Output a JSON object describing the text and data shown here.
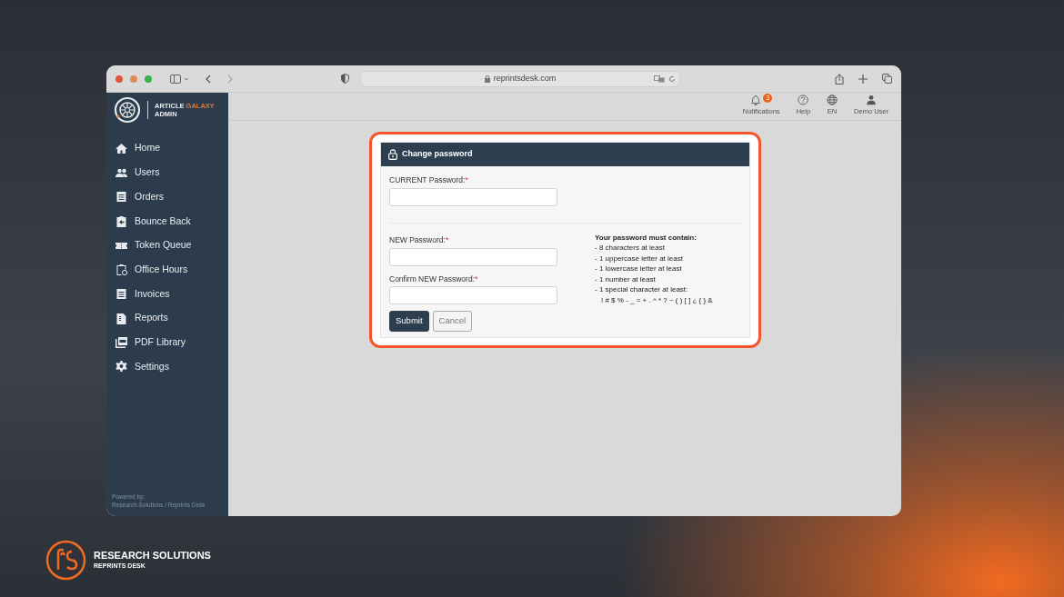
{
  "browser": {
    "url": "reprintsdesk.com"
  },
  "logo": {
    "word_1": "ARTICLE",
    "word_2": "GALAXY",
    "word_3": "ADMIN"
  },
  "sidebar": {
    "items": [
      {
        "label": "Home"
      },
      {
        "label": "Users"
      },
      {
        "label": "Orders"
      },
      {
        "label": "Bounce Back"
      },
      {
        "label": "Token Queue"
      },
      {
        "label": "Office Hours"
      },
      {
        "label": "Invoices"
      },
      {
        "label": "Reports"
      },
      {
        "label": "PDF Library"
      },
      {
        "label": "Settings"
      }
    ],
    "footer": [
      "Powered by:",
      "Research Solutions / Reprints Desk"
    ]
  },
  "header": {
    "items": [
      {
        "label": "Notifications",
        "badge": "3"
      },
      {
        "label": "Help"
      },
      {
        "label": "EN"
      },
      {
        "label": "Demo User"
      }
    ]
  },
  "dialog": {
    "title": "Change password",
    "current_field": {
      "label": "CURRENT Password:",
      "required_mark": "*"
    },
    "new_fields": [
      {
        "label": "NEW Password:",
        "required_mark": "*"
      },
      {
        "label": "Confirm NEW Password:",
        "required_mark": "*"
      }
    ],
    "rules": {
      "heading": "Your password must contain:",
      "items": [
        "- 8 characters at least",
        "- 1 uppercase letter at least",
        "- 1 lowercase letter at least",
        "- 1 number at least",
        "- 1 special character at least:"
      ],
      "special_characters": "! # $ % - _ = + . ^ * ? ~ ( ) [ ] ¿ { } &"
    },
    "buttons": [
      {
        "label": "Submit",
        "kind": "primary"
      },
      {
        "label": "Cancel",
        "kind": "secondary"
      }
    ]
  },
  "brand": {
    "name": "RESEARCH SOLUTIONS",
    "subtitle": "REPRINTS DESK"
  }
}
